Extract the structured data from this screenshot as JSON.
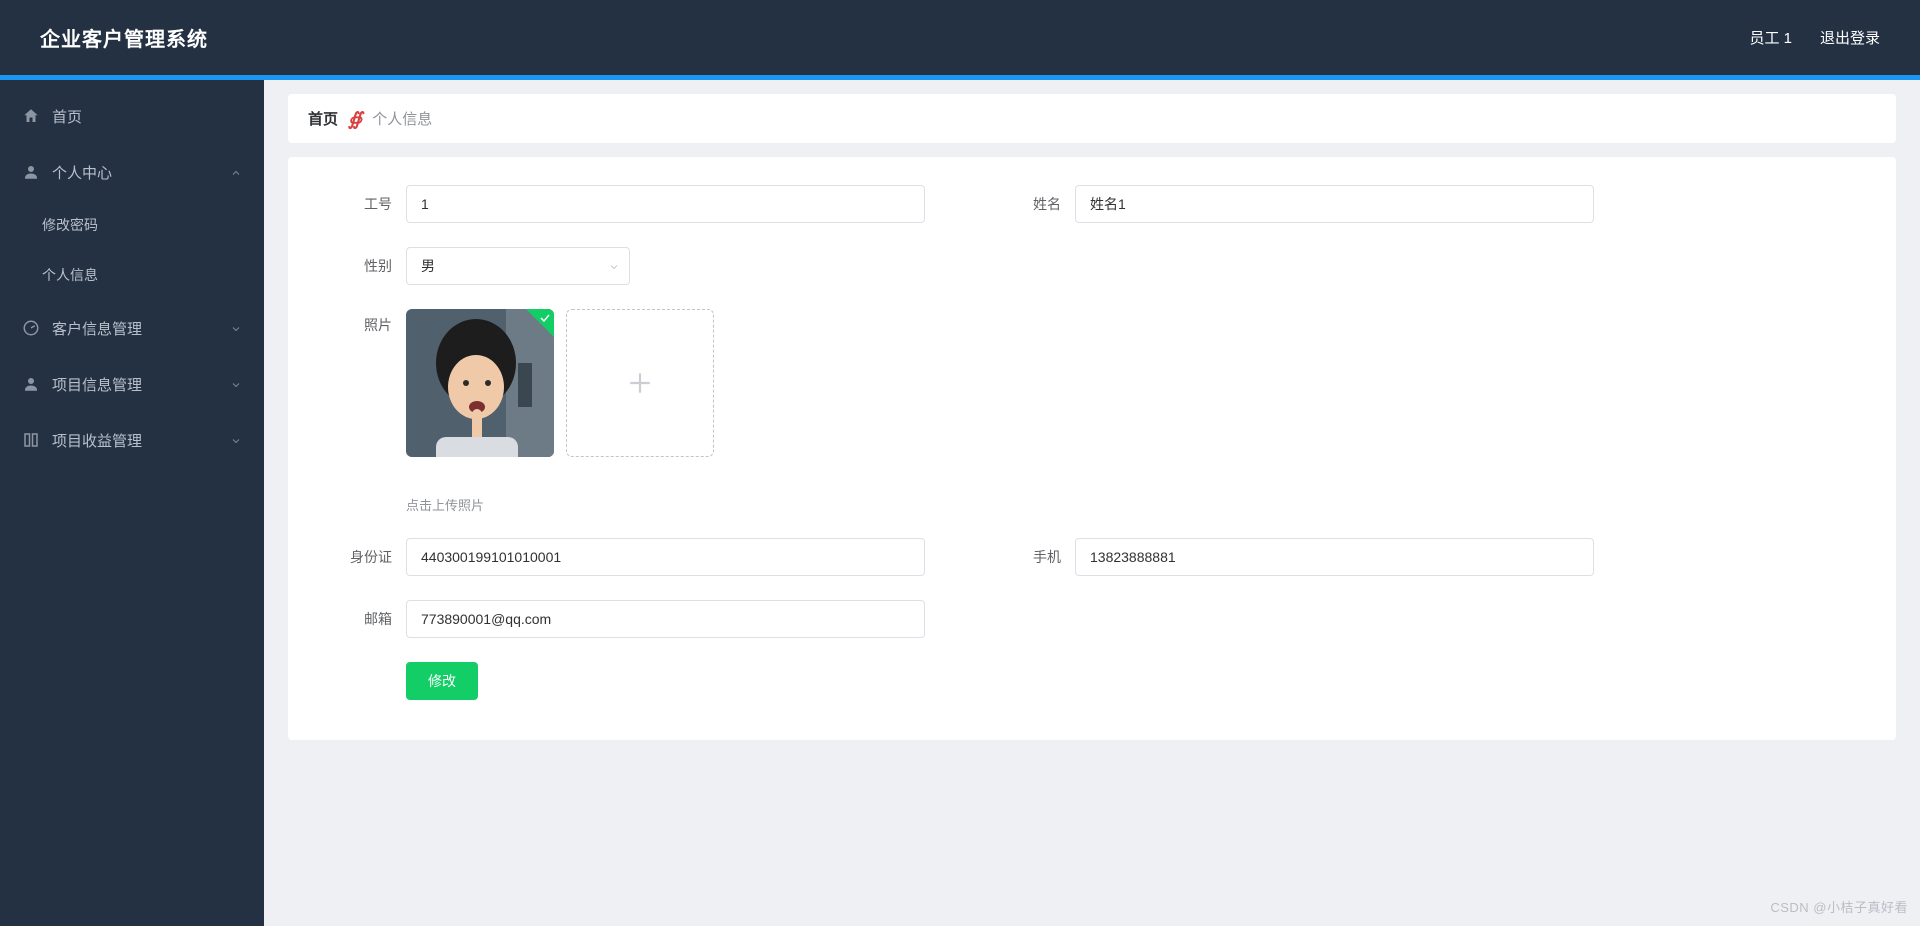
{
  "header": {
    "brand": "企业客户管理系统",
    "user_label": "员工 1",
    "logout_label": "退出登录"
  },
  "sidebar": {
    "items": [
      {
        "icon": "home-icon",
        "label": "首页"
      },
      {
        "icon": "user-icon",
        "label": "个人中心",
        "expanded": true,
        "children": [
          {
            "label": "修改密码"
          },
          {
            "label": "个人信息"
          }
        ]
      },
      {
        "icon": "gauge-icon",
        "label": "客户信息管理"
      },
      {
        "icon": "user-solid-icon",
        "label": "项目信息管理"
      },
      {
        "icon": "column-icon",
        "label": "项目收益管理"
      }
    ]
  },
  "breadcrumb": {
    "home": "首页",
    "current": "个人信息"
  },
  "form": {
    "labels": {
      "emp_no": "工号",
      "name": "姓名",
      "gender": "性别",
      "photo": "照片",
      "id_card": "身份证",
      "phone": "手机",
      "email": "邮箱"
    },
    "values": {
      "emp_no": "1",
      "name": "姓名1",
      "gender": "男",
      "id_card": "440300199101010001",
      "phone": "13823888881",
      "email": "773890001@qq.com"
    },
    "hint": "点击上传照片",
    "submit_label": "修改"
  },
  "watermark": "CSDN @小桔子真好看"
}
